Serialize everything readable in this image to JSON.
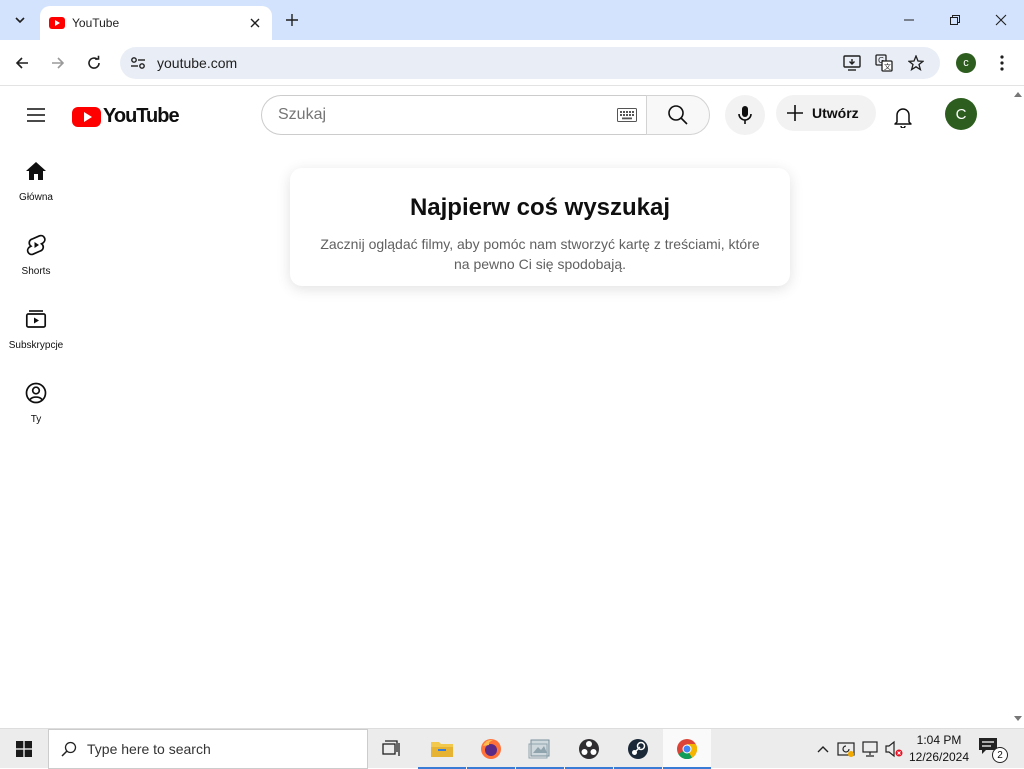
{
  "browser": {
    "tab_title": "YouTube",
    "url": "youtube.com",
    "profile_initial": "c"
  },
  "youtube": {
    "logo_text": "YouTube",
    "search_placeholder": "Szukaj",
    "create_label": "Utwórz",
    "avatar_initial": "C",
    "guide": [
      {
        "label": "Główna",
        "icon": "home-icon"
      },
      {
        "label": "Shorts",
        "icon": "shorts-icon"
      },
      {
        "label": "Subskrypcje",
        "icon": "subscriptions-icon"
      },
      {
        "label": "Ty",
        "icon": "you-icon"
      }
    ],
    "empty_state": {
      "title": "Najpierw coś wyszukaj",
      "body": "Zacznij oglądać filmy, aby pomóc nam stworzyć kartę z treściami, które na pewno Ci się spodobają."
    }
  },
  "taskbar": {
    "search_placeholder": "Type here to search",
    "time": "1:04 PM",
    "date": "12/26/2024",
    "notification_count": "2"
  },
  "colors": {
    "brand_red": "#ff0000",
    "avatar_green": "#2e5e1f",
    "chrome_frame": "#d3e3fd"
  }
}
